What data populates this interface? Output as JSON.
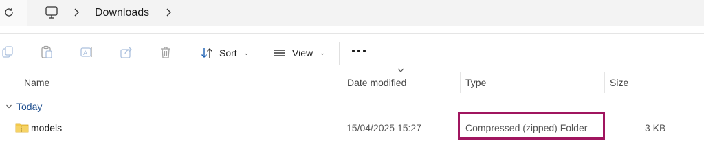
{
  "address_bar": {
    "refresh_icon": "refresh-icon",
    "pc_icon": "computer-icon",
    "breadcrumb": [
      "Downloads"
    ]
  },
  "toolbar": {
    "disabled_icons": [
      "copy-icon",
      "paste-icon",
      "rename-icon",
      "share-icon",
      "delete-icon"
    ],
    "sort_label": "Sort",
    "view_label": "View",
    "more_icon": "more-icon"
  },
  "columns": {
    "name": "Name",
    "date": "Date modified",
    "type": "Type",
    "size": "Size"
  },
  "groups": [
    {
      "label": "Today",
      "files": [
        {
          "name": "models",
          "date": "15/04/2025 15:27",
          "type": "Compressed (zipped) Folder",
          "size": "3 KB",
          "icon": "zip-folder-icon"
        }
      ]
    }
  ],
  "colors": {
    "highlight_border": "#a0155f",
    "group_label": "#1f4f8f",
    "folder_yellow": "#f2c94c"
  }
}
